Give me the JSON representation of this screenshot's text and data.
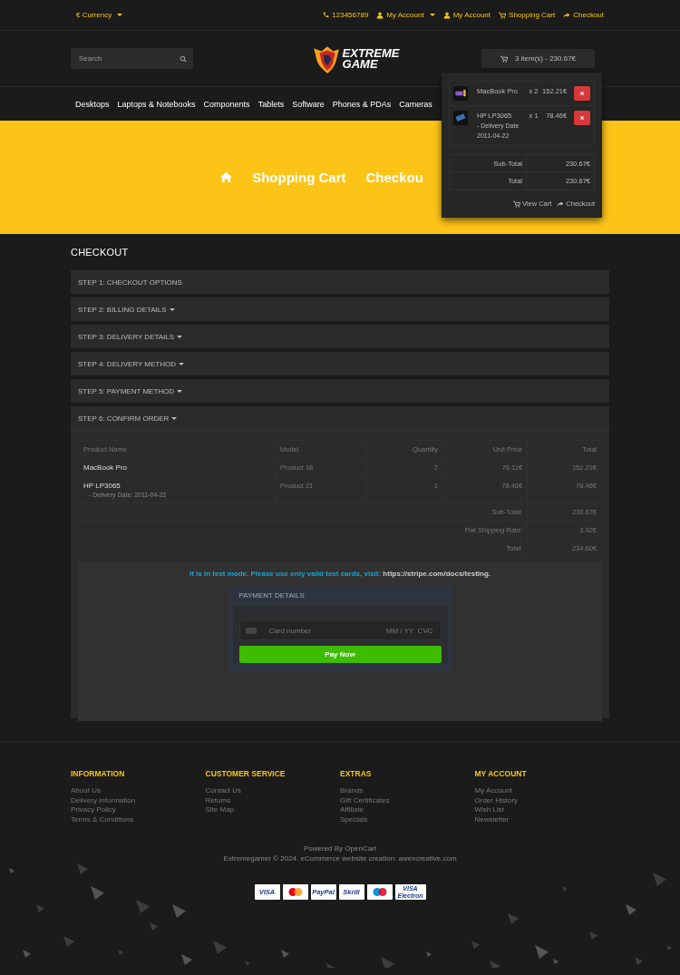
{
  "top_bar": {
    "currency": "€ Currency",
    "links": [
      {
        "kind": "phone",
        "label": "123456789",
        "dropdown": false
      },
      {
        "kind": "user",
        "label": "My Account",
        "dropdown": true
      },
      {
        "kind": "user",
        "label": "My Account",
        "dropdown": false
      },
      {
        "kind": "cart",
        "label": "Shopping Cart",
        "dropdown": false
      },
      {
        "kind": "share",
        "label": "Checkout",
        "dropdown": false
      }
    ]
  },
  "header": {
    "search": {
      "placeholder": "Search"
    },
    "logo": [
      "EXTREME",
      "GAME"
    ],
    "cart_button": "3 item(s) - 230.67€"
  },
  "nav": [
    "Desktops",
    "Laptops & Notebooks",
    "Components",
    "Tablets",
    "Software",
    "Phones & PDAs",
    "Cameras"
  ],
  "breadcrumb": [
    {
      "kind": "home"
    },
    {
      "kind": "link",
      "label": "Shopping Cart"
    },
    {
      "kind": "link",
      "label": "Checkou"
    }
  ],
  "cart_dropdown": {
    "items": [
      {
        "name": "MacBook Pro",
        "quantity": "x 2",
        "price": "152.21€"
      },
      {
        "name": "HP LP3065",
        "option": "- Delivery Date 2011-04-22",
        "quantity": "x 1",
        "price": "78.46€"
      }
    ],
    "totals": [
      {
        "label": "Sub-Total",
        "value": "230.67€"
      },
      {
        "label": "Total",
        "value": "230.67€"
      }
    ],
    "links": [
      {
        "kind": "cart",
        "label": "View Cart"
      },
      {
        "kind": "share",
        "label": "Checkout"
      }
    ]
  },
  "page_title": "CHECKOUT",
  "steps": [
    {
      "label": "STEP 1: CHECKOUT OPTIONS",
      "dropdown": false,
      "expanded": false
    },
    {
      "label": "STEP 2: BILLING DETAILS",
      "dropdown": true,
      "expanded": false
    },
    {
      "label": "STEP 3: DELIVERY DETAILS",
      "dropdown": true,
      "expanded": false
    },
    {
      "label": "STEP 4: DELIVERY METHOD",
      "dropdown": true,
      "expanded": false
    },
    {
      "label": "STEP 5: PAYMENT METHOD",
      "dropdown": true,
      "expanded": false
    },
    {
      "label": "STEP 6: CONFIRM ORDER",
      "dropdown": true,
      "expanded": true
    }
  ],
  "order": {
    "columns": [
      "Product Name",
      "Model",
      "Quantity",
      "Unit Price",
      "Total"
    ],
    "rows": [
      {
        "product": "MacBook Pro",
        "model": "Product 18",
        "quantity": "2",
        "unit_price": "76.11€",
        "total": "152.21€"
      },
      {
        "product": "HP LP3065",
        "option": "- Delivery Date: 2011-04-22",
        "model": "Product 21",
        "quantity": "1",
        "unit_price": "78.46€",
        "total": "78.46€"
      }
    ],
    "totals": [
      {
        "label": "Sub-Total:",
        "value": "230.67€"
      },
      {
        "label": "Flat Shipping Rate:",
        "value": "3.92€"
      },
      {
        "label": "Total:",
        "value": "234.60€"
      }
    ]
  },
  "payment": {
    "notice": "It is in test mode. Please use only valid test cards, visit:",
    "notice_link": "https://stripe.com/docs/testing.",
    "title": "PAYMENT DETAILS",
    "card_placeholder": "Card number",
    "expiry_placeholder": "MM / YY  CVC",
    "button": "Pay Now"
  },
  "footer": {
    "columns": [
      {
        "title": "INFORMATION",
        "links": [
          "About Us",
          "Delivery Information",
          "Privacy Policy",
          "Terms & Conditions"
        ]
      },
      {
        "title": "CUSTOMER SERVICE",
        "links": [
          "Contact Us",
          "Returns",
          "Site Map"
        ]
      },
      {
        "title": "EXTRAS",
        "links": [
          "Brands",
          "Gift Certificates",
          "Affiliate",
          "Specials"
        ]
      },
      {
        "title": "MY ACCOUNT",
        "links": [
          "My Account",
          "Order History",
          "Wish List",
          "Newsletter"
        ]
      }
    ],
    "powered": "Powered By OpenCart",
    "copyright": "Extremegamer © 2024. eCommerce website creation: awexcreative.com",
    "payment_logos": [
      {
        "kind": "text",
        "label": "VISA"
      },
      {
        "kind": "circles"
      },
      {
        "kind": "text",
        "label": "PayPal"
      },
      {
        "kind": "text",
        "label": "Skrill"
      },
      {
        "kind": "circles"
      },
      {
        "kind": "text",
        "label": "VISA Electron"
      }
    ]
  }
}
